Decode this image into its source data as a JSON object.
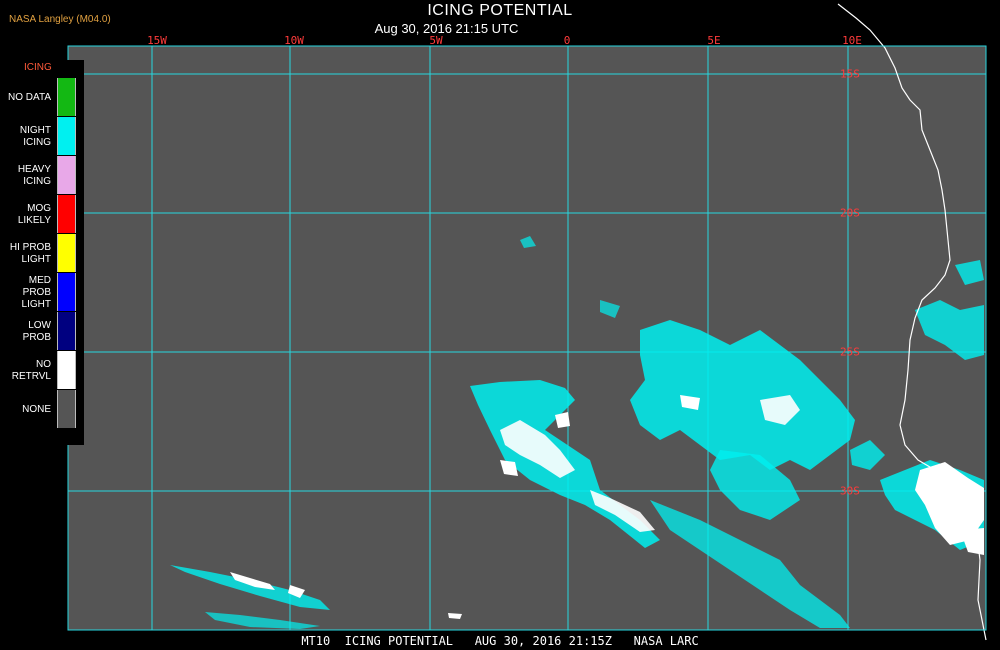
{
  "header": {
    "credit": "NASA Langley (M04.0)",
    "title": "ICING POTENTIAL",
    "datetime": "Aug 30, 2016 21:15 UTC"
  },
  "map": {
    "background_color": "#555555",
    "grid_color": "#27d6e0",
    "label_color": "#ff3b3b",
    "lon_labels": [
      "15W",
      "10W",
      "5W",
      "0",
      "5E",
      "10E"
    ],
    "lat_labels": [
      "15S",
      "20S",
      "25S",
      "30S"
    ]
  },
  "legend": {
    "heading": "ICING",
    "items": [
      {
        "label": "NO DATA",
        "color": "#13b813"
      },
      {
        "label": "NIGHT\nICING",
        "color": "#00f0f0"
      },
      {
        "label": "HEAVY\nICING",
        "color": "#e8a8e8"
      },
      {
        "label": "MOG\nLIKELY",
        "color": "#ff0000"
      },
      {
        "label": "HI PROB\nLIGHT",
        "color": "#ffff00"
      },
      {
        "label": "MED PROB\nLIGHT",
        "color": "#0000ff"
      },
      {
        "label": "LOW\nPROB",
        "color": "#000080"
      },
      {
        "label": "NO\nRETRVL",
        "color": "#ffffff"
      },
      {
        "label": "NONE",
        "color": "#555555"
      }
    ]
  },
  "footer": {
    "text": "MT10  ICING POTENTIAL   AUG 30, 2016 21:15Z   NASA LARC"
  }
}
